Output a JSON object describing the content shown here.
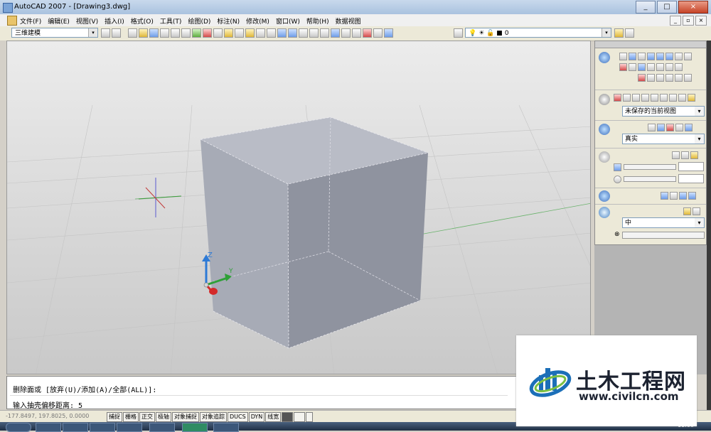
{
  "window": {
    "title": "AutoCAD 2007 - [Drawing3.dwg]",
    "btn_min": "_",
    "btn_max": "□",
    "btn_close": "×"
  },
  "menu": {
    "items": [
      "文件(F)",
      "编辑(E)",
      "视图(V)",
      "插入(I)",
      "格式(O)",
      "工具(T)",
      "绘图(D)",
      "标注(N)",
      "修改(M)",
      "窗口(W)",
      "帮助(H)",
      "数据视图"
    ],
    "mdi_min": "_",
    "mdi_restore": "▫",
    "mdi_close": "×"
  },
  "toolbar": {
    "workspace": "三维建模",
    "layer_value": "0",
    "arrow": "▾"
  },
  "viewport": {
    "ucs_z": "Z",
    "ucs_y": "Y",
    "bg_top": "#ececec",
    "box_face": "#a6abb7"
  },
  "dashboard": {
    "view_combo": "未保存的当前视图",
    "visual_style_combo": "真实",
    "quality_combo": "中",
    "arrow": "▾"
  },
  "command": {
    "line1": "删除面或 [放弃(U)/添加(A)/全部(ALL)]:",
    "line2": "输入抽壳偏移距离: 5"
  },
  "status": {
    "coords": "-177.8497, 197.8025, 0.0000",
    "buttons": [
      "捕捉",
      "栅格",
      "正交",
      "极轴",
      "对象捕捉",
      "对象追踪",
      "DUCS",
      "DYN",
      "线宽"
    ]
  },
  "taskbar": {
    "clock": "11:08"
  },
  "watermark": {
    "cn": "土木工程网",
    "url": "www.civilcn.com",
    "brand_color": "#1c6fb8"
  }
}
